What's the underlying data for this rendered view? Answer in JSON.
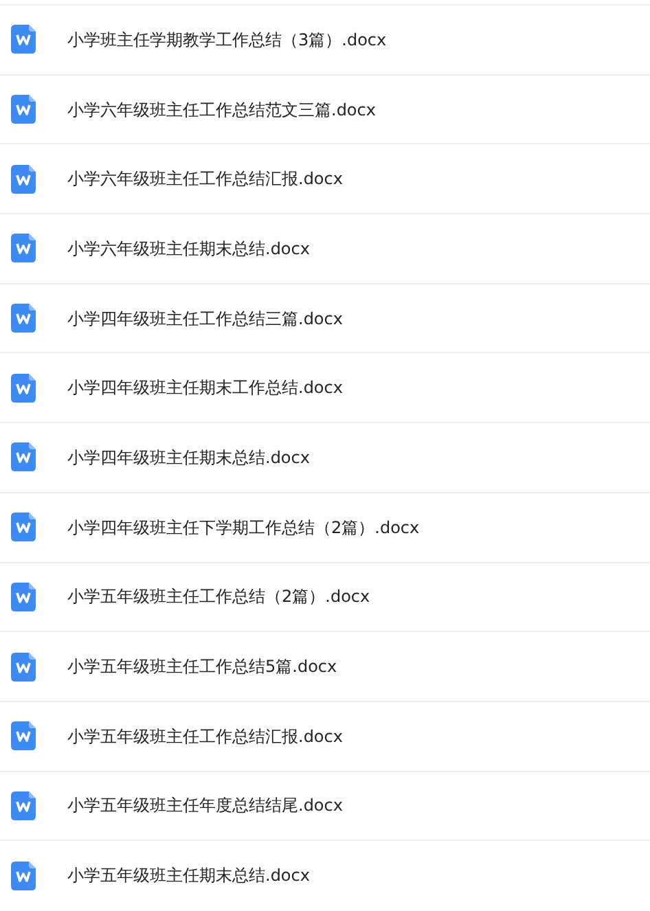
{
  "files": [
    {
      "name": "小学班主任学期教学工作总结（3篇）.docx"
    },
    {
      "name": "小学六年级班主任工作总结范文三篇.docx"
    },
    {
      "name": "小学六年级班主任工作总结汇报.docx"
    },
    {
      "name": "小学六年级班主任期末总结.docx"
    },
    {
      "name": "小学四年级班主任工作总结三篇.docx"
    },
    {
      "name": "小学四年级班主任期末工作总结.docx"
    },
    {
      "name": "小学四年级班主任期末总结.docx"
    },
    {
      "name": "小学四年级班主任下学期工作总结（2篇）.docx"
    },
    {
      "name": "小学五年级班主任工作总结（2篇）.docx"
    },
    {
      "name": "小学五年级班主任工作总结5篇.docx"
    },
    {
      "name": "小学五年级班主任工作总结汇报.docx"
    },
    {
      "name": "小学五年级班主任年度总结结尾.docx"
    },
    {
      "name": "小学五年级班主任期末总结.docx"
    }
  ]
}
